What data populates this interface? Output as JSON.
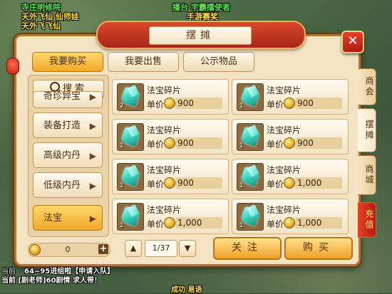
{
  "scene": {
    "top_lines": [
      "寺庄明修院",
      "天外飞仙 仙师娃",
      "天外飞飞仙"
    ],
    "top_right_lines": [
      "播台 宇霸擂使者",
      "手游赛奖"
    ],
    "chat_lines": [
      "当前",
      "64~95进组啦【申请入队】",
      "当前 [剧老师]60剧情 求人带！",
      "成功 易语"
    ]
  },
  "window": {
    "title": "摆摊",
    "close_label": "✕"
  },
  "tabs": [
    {
      "label": "我要购买",
      "active": true
    },
    {
      "label": "我要出售",
      "active": false
    },
    {
      "label": "公示物品",
      "active": false
    }
  ],
  "side": {
    "search_label": "搜索",
    "categories": [
      {
        "label": "奇珍异宝",
        "active": false
      },
      {
        "label": "装备打造",
        "active": false
      },
      {
        "label": "高级内丹",
        "active": false
      },
      {
        "label": "低级内丹",
        "active": false
      },
      {
        "label": "法宝",
        "active": true
      }
    ]
  },
  "goods": [
    {
      "name": "法宝碎片",
      "price_label": "单价",
      "price": "900",
      "qty": "2"
    },
    {
      "name": "法宝碎片",
      "price_label": "单价",
      "price": "900",
      "qty": "1"
    },
    {
      "name": "法宝碎片",
      "price_label": "单价",
      "price": "900",
      "qty": "1"
    },
    {
      "name": "法宝碎片",
      "price_label": "单价",
      "price": "900",
      "qty": "1"
    },
    {
      "name": "法宝碎片",
      "price_label": "单价",
      "price": "900",
      "qty": "1"
    },
    {
      "name": "法宝碎片",
      "price_label": "单价",
      "price": "1,000",
      "qty": "1"
    },
    {
      "name": "法宝碎片",
      "price_label": "单价",
      "price": "1,000",
      "qty": "1"
    },
    {
      "name": "法宝碎片",
      "price_label": "单价",
      "price": "1,000",
      "qty": "1"
    }
  ],
  "footer": {
    "money": "0",
    "plus_label": "+",
    "page": "1/37",
    "prev_label": "▲",
    "next_label": "▼",
    "follow_label": "关注",
    "buy_label": "购买"
  },
  "right_tabs": [
    {
      "label": "商会",
      "active": false
    },
    {
      "label": "摆摊",
      "active": true
    },
    {
      "label": "商城",
      "active": false
    },
    {
      "label": "充值",
      "active": false
    }
  ],
  "colors": {
    "accent": "#f2a82a",
    "frame": "#b27935",
    "title_red": "#a8261a",
    "gem": "#3fd8c0"
  }
}
